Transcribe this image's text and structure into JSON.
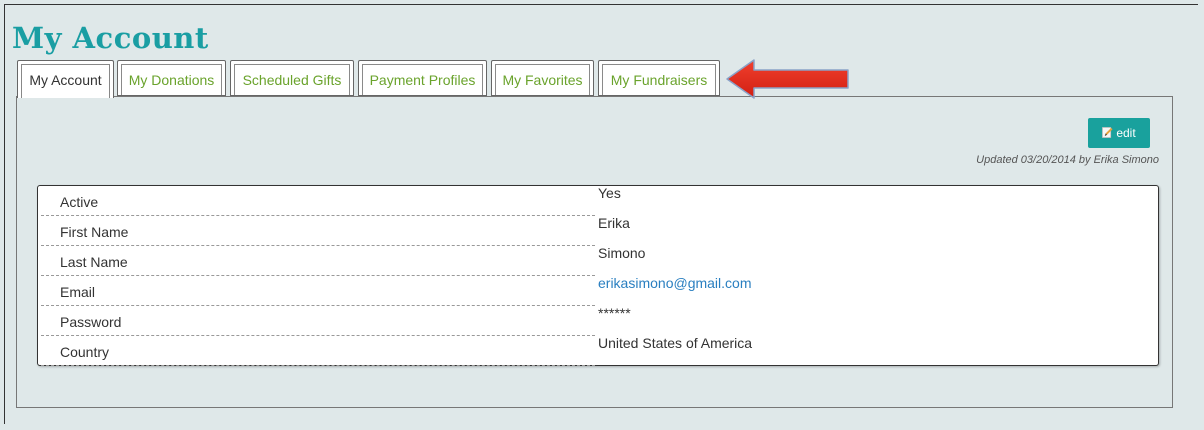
{
  "page": {
    "title": "My Account"
  },
  "tabs": [
    {
      "label": "My Account",
      "active": true
    },
    {
      "label": "My Donations",
      "active": false
    },
    {
      "label": "Scheduled Gifts",
      "active": false
    },
    {
      "label": "Payment Profiles",
      "active": false
    },
    {
      "label": "My Favorites",
      "active": false
    },
    {
      "label": "My Fundraisers",
      "active": false
    }
  ],
  "toolbar": {
    "edit_label": "edit",
    "edit_icon": "pencil-document-icon",
    "updated_text": "Updated 03/20/2014 by Erika Simono"
  },
  "account": {
    "rows": [
      {
        "label": "Active",
        "value": "Yes"
      },
      {
        "label": "First Name",
        "value": "Erika"
      },
      {
        "label": "Last Name",
        "value": "Simono"
      },
      {
        "label": "Email",
        "value": "erikasimono@gmail.com"
      },
      {
        "label": "Password",
        "value": "******"
      },
      {
        "label": "Country",
        "value": "United States of America"
      }
    ]
  },
  "annotation": {
    "arrow_color": "#e8291c",
    "arrow_icon": "red-arrow-icon"
  },
  "colors": {
    "brand_teal": "#1a9ea3",
    "tab_text_green": "#6aa32c",
    "link_blue": "#2a7fc0",
    "background": "#dfe8e9"
  }
}
